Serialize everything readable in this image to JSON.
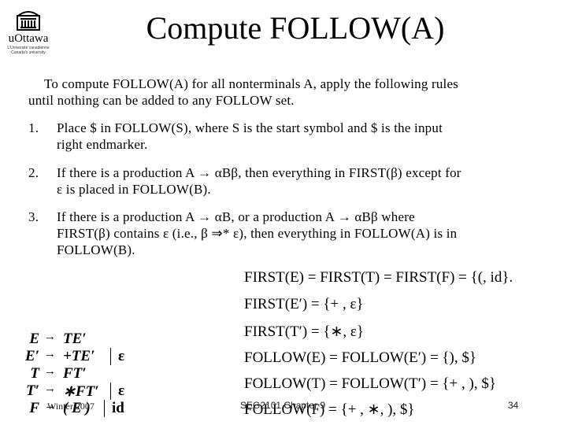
{
  "slide": {
    "title": "Compute FOLLOW(A)",
    "logo": {
      "name": "uOttawa",
      "tagline_1": "L'Université canadienne",
      "tagline_2": "Canada's university",
      "icon": "university-building-icon"
    },
    "intro": {
      "line_1": "To compute FOLLOW(A) for all nonterminals A, apply the following rules",
      "line_2": "until nothing can be added to any FOLLOW set."
    },
    "rules": [
      {
        "number": "1.",
        "line_1": "Place $ in FOLLOW(S), where S is the start symbol and $ is the input",
        "line_2": "right endmarker."
      },
      {
        "number": "2.",
        "line_1": "If there is a production A → αBβ, then everything in FIRST(β) except for",
        "line_2": "ε is placed in FOLLOW(B)."
      },
      {
        "number": "3.",
        "line_1": "If there is a production  A → αB,  or  a  production  A → αBβ  where",
        "line_2": "FIRST(β) contains ε (i.e., β ⇒* ε), then everything in FOLLOW(A) is in",
        "line_3": "FOLLOW(B)."
      }
    ],
    "sets": [
      "FIRST(E) = FIRST(T) = FIRST(F) = {(, id}.",
      "FIRST(E′) = {+ , ε}",
      "FIRST(T′) = {∗, ε}",
      "FOLLOW(E) = FOLLOW(E′) = {), $}",
      "FOLLOW(T) = FOLLOW(T′) = {+ , ), $}",
      "FOLLOW(F) = {+ , ∗, ), $}"
    ],
    "grammar": [
      {
        "lhs": "E",
        "arrow": "→",
        "rhs": "TE′",
        "alt": ""
      },
      {
        "lhs": "E′",
        "arrow": "→",
        "rhs": "+TE′",
        "alt": "ε"
      },
      {
        "lhs": "T",
        "arrow": "→",
        "rhs": "FT′",
        "alt": ""
      },
      {
        "lhs": "T′",
        "arrow": "→",
        "rhs": "∗FT′",
        "alt": "ε"
      },
      {
        "lhs": "F",
        "arrow": "→",
        "rhs": "( E )",
        "alt": "id"
      }
    ],
    "footer": {
      "left": "Winter 2007",
      "center": "SEG2101 Chapter 9",
      "page": "34"
    }
  }
}
